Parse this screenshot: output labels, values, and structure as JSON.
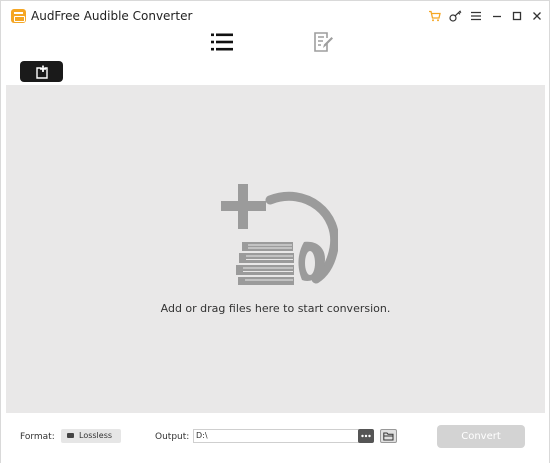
{
  "window": {
    "title": "AudFree Audible Converter",
    "icons": [
      "cart-icon",
      "key-icon",
      "menu-icon",
      "minimize-icon",
      "maximize-icon",
      "close-icon"
    ]
  },
  "toolbar": {
    "tabs": [
      {
        "name": "file-list-tab",
        "icon": "list-icon"
      },
      {
        "name": "history-tab",
        "icon": "edit-document-icon"
      }
    ],
    "add_button_icon": "add-files-icon"
  },
  "main": {
    "hint": "Add or drag files here to start conversion."
  },
  "bottom": {
    "format_label": "Format:",
    "format_value": "Lossless",
    "output_label": "Output:",
    "output_value": "D:\\",
    "convert_label": "Convert"
  },
  "colors": {
    "accent": "#f5a623",
    "drop_area_bg": "#e9e8e8",
    "graphic_gray": "#9b9b9b",
    "convert_disabled": "#d3d3d3"
  }
}
